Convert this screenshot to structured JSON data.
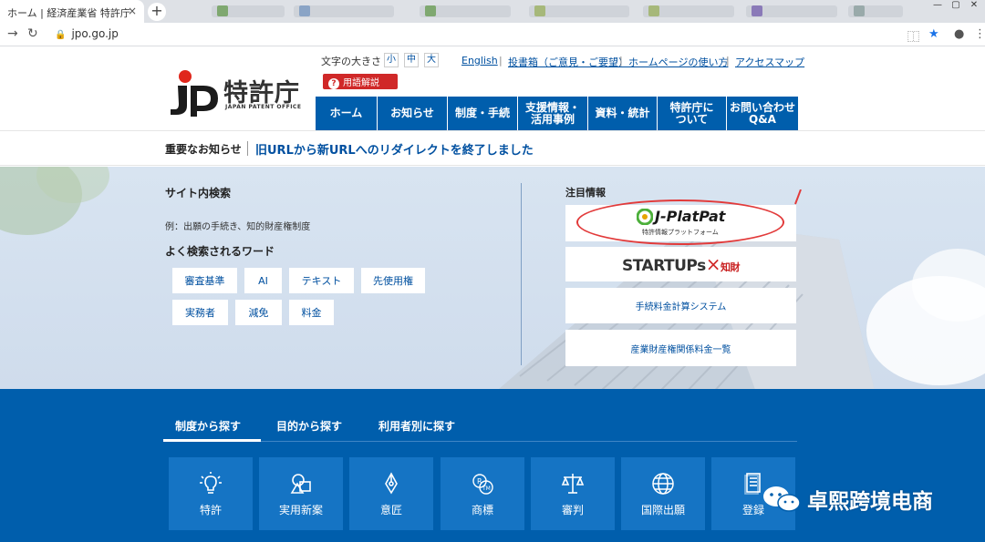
{
  "browser": {
    "active_tab_title": "ホーム | 経済産業省 特許庁",
    "close_glyph": "×",
    "new_tab_glyph": "+",
    "url": "jpo.go.jp",
    "minimize_glyph": "—",
    "maximize_glyph": "▢",
    "close_window_glyph": "✕"
  },
  "header": {
    "logo_name": "特許庁",
    "logo_sub": "JAPAN PATENT OFFICE",
    "fontsize_label": "文字の大きさ",
    "fontsize_options": [
      "小",
      "中",
      "大"
    ],
    "glossary_label": "用語解説",
    "util_links": [
      "English",
      "投書箱（ご意見・ご要望）",
      "ホームページの使い方",
      "アクセスマップ"
    ],
    "util_separator": "|",
    "nav": [
      "ホーム",
      "お知らせ",
      "制度・手続",
      "支援情報・\n活用事例",
      "資料・統計",
      "特許庁に\nついて",
      "お問い合わせ\nQ&A"
    ]
  },
  "notice": {
    "label": "重要なお知らせ",
    "link": "旧URLから新URLへのリダイレクトを終了しました"
  },
  "search": {
    "title": "サイト内検索",
    "placeholder": "例：出願の手続き、知的財産権制度",
    "frequent_title": "よく検索されるワード",
    "keywords": [
      "審査基準",
      "AI",
      "テキスト",
      "先使用権",
      "実務者",
      "減免",
      "料金"
    ]
  },
  "attention": {
    "title": "注目情報",
    "jplatpat": "J-PlatPat",
    "jplatpat_sub": "特許情報プラットフォーム",
    "startups": "STARTUPs",
    "startups_x": "×",
    "startups_kz": "知財",
    "fee_calc": "手続料金計算システム",
    "fee_list": "産業財産権関係料金一覧"
  },
  "categories": {
    "tabs": [
      "制度から探す",
      "目的から探す",
      "利用者別に探す"
    ],
    "cards": [
      "特許",
      "実用新案",
      "意匠",
      "商標",
      "審判",
      "国際出願",
      "登録"
    ]
  },
  "watermark": {
    "text": "卓熙跨境电商"
  },
  "colors": {
    "brand_blue": "#005eac",
    "card_blue": "#1574c4",
    "link_blue": "#0050a0",
    "alert_red": "#d02828"
  }
}
